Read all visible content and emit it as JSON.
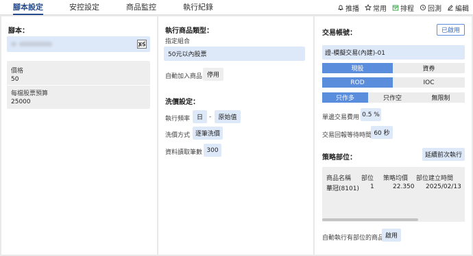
{
  "tabs": [
    "腳本設定",
    "安控設定",
    "商品監控",
    "執行紀錄"
  ],
  "tools": [
    {
      "icon": "bell-icon",
      "label": "推播"
    },
    {
      "icon": "star-icon",
      "label": "常用"
    },
    {
      "icon": "calendar-icon",
      "label": "排程"
    },
    {
      "icon": "history-icon",
      "label": "回測"
    },
    {
      "icon": "edit-icon",
      "label": "編輯"
    }
  ],
  "left": {
    "script_title": "腳本：",
    "script_icon": "xs-script-icon",
    "price_label": "價格",
    "price_value": "50",
    "budget_label": "每檔股票預算",
    "budget_value": "25000"
  },
  "middle": {
    "product_type_title": "執行商品類型：",
    "combo_label": "指定組合",
    "combo_value": "50元以內股票",
    "auto_add_label": "自動加入商品",
    "auto_add_value": "停用",
    "wash_title": "洗價設定：",
    "freq_label": "執行頻率",
    "freq_value": "日",
    "freq_sep": "-",
    "freq_mode": "原始值",
    "method_label": "洗價方式",
    "method_value": "逐筆洗價",
    "count_label": "資料讀取筆數",
    "count_value": "300"
  },
  "right": {
    "account_title": "交易帳號：",
    "enabled_btn": "已啟用",
    "account_value": "證-模擬交易(內建)-01",
    "seg1": [
      "現股",
      "資券"
    ],
    "seg2": [
      "ROD",
      "IOC"
    ],
    "seg3": [
      "只作多",
      "只作空",
      "無限制"
    ],
    "fee_label": "單邊交易費用",
    "fee_value": "0.5 %",
    "wait_label": "交易回報等待時間",
    "wait_value": "60 秒",
    "position_title": "策略部位：",
    "delay_btn": "延續前次執行",
    "table_headers": [
      "商品名稱",
      "部位",
      "策略均價",
      "部位建立時間"
    ],
    "table_rows": [
      [
        "華冠(8101)",
        "1",
        "22.350",
        "2025/02/13"
      ]
    ],
    "auto_exec_label": "自動執行有部位的商品",
    "auto_exec_value": "啟用"
  },
  "colors": {
    "accent": "#234a8c",
    "segment_on": "#5b8ddd",
    "field": "#dde8f8"
  }
}
